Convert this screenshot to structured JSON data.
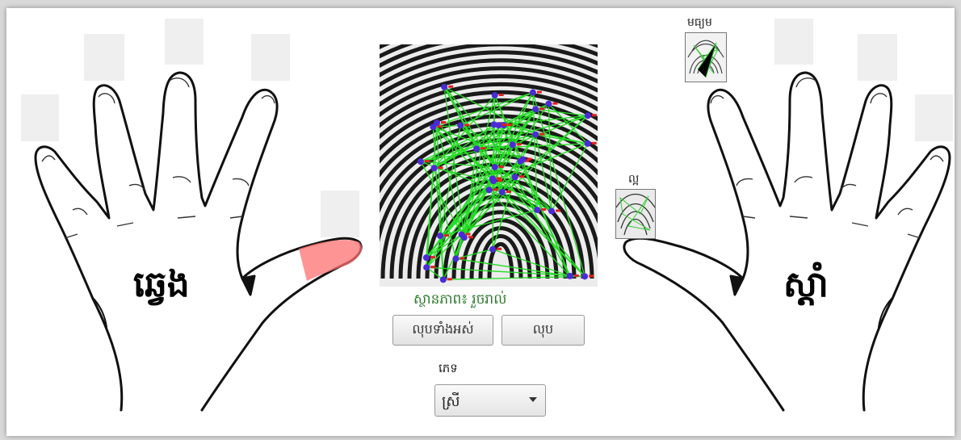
{
  "hands": {
    "left_label": "ឆ្វេង",
    "right_label": "ស្តាំ"
  },
  "fingers": {
    "right_middle_label": "មធ្យម",
    "right_thumb_label": "ល្អ"
  },
  "status": {
    "text": "ស្ថានភាព៖ រួចរាល់"
  },
  "buttons": {
    "delete_all": "លុបទាំងអស់",
    "delete": "លុប"
  },
  "gender": {
    "label": "ភេទ",
    "selected": "ស្រី"
  },
  "colors": {
    "status": "#2d7a2d",
    "minutiae_line": "#22dd22",
    "minutiae_point": "#4a2bd6",
    "minutiae_marker": "#e02020",
    "highlight": "#ff6666"
  },
  "icons": {
    "dropdown": "chevron-down-icon"
  }
}
